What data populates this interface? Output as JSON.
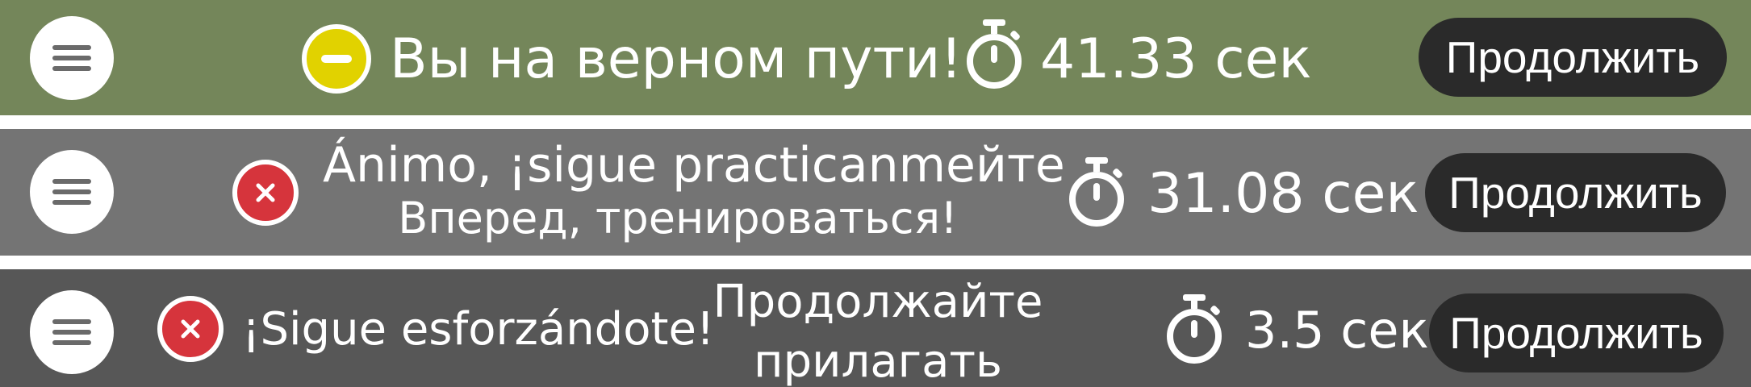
{
  "rows": [
    {
      "status": "neutral",
      "message": "Вы на верном пути!",
      "time": "41.33 сек",
      "button": "Продолжить"
    },
    {
      "status": "wrong",
      "message_line1": "Ánimo, ¡sigue practicanmeйте",
      "message_line2": "Вперед, тренироваться!",
      "time": "31.08 сек",
      "button": "Продолжить"
    },
    {
      "status": "wrong",
      "message": "¡Sigue esforzándote!",
      "message2_line1": "Продолжайте",
      "message2_line2": "прилагать",
      "time": "3.5 сек",
      "button": "Продолжить"
    }
  ],
  "colors": {
    "row1_background": "#74865a",
    "row2_background": "#747474",
    "row3_background": "#575757",
    "neutral_status": "#e1d200",
    "wrong_status": "#d6343c",
    "button_background": "#2a2a2a"
  },
  "icons": {
    "menu": "hamburger-menu-icon",
    "neutral": "minus-circle-icon",
    "wrong": "x-circle-icon",
    "timer": "stopwatch-icon"
  }
}
